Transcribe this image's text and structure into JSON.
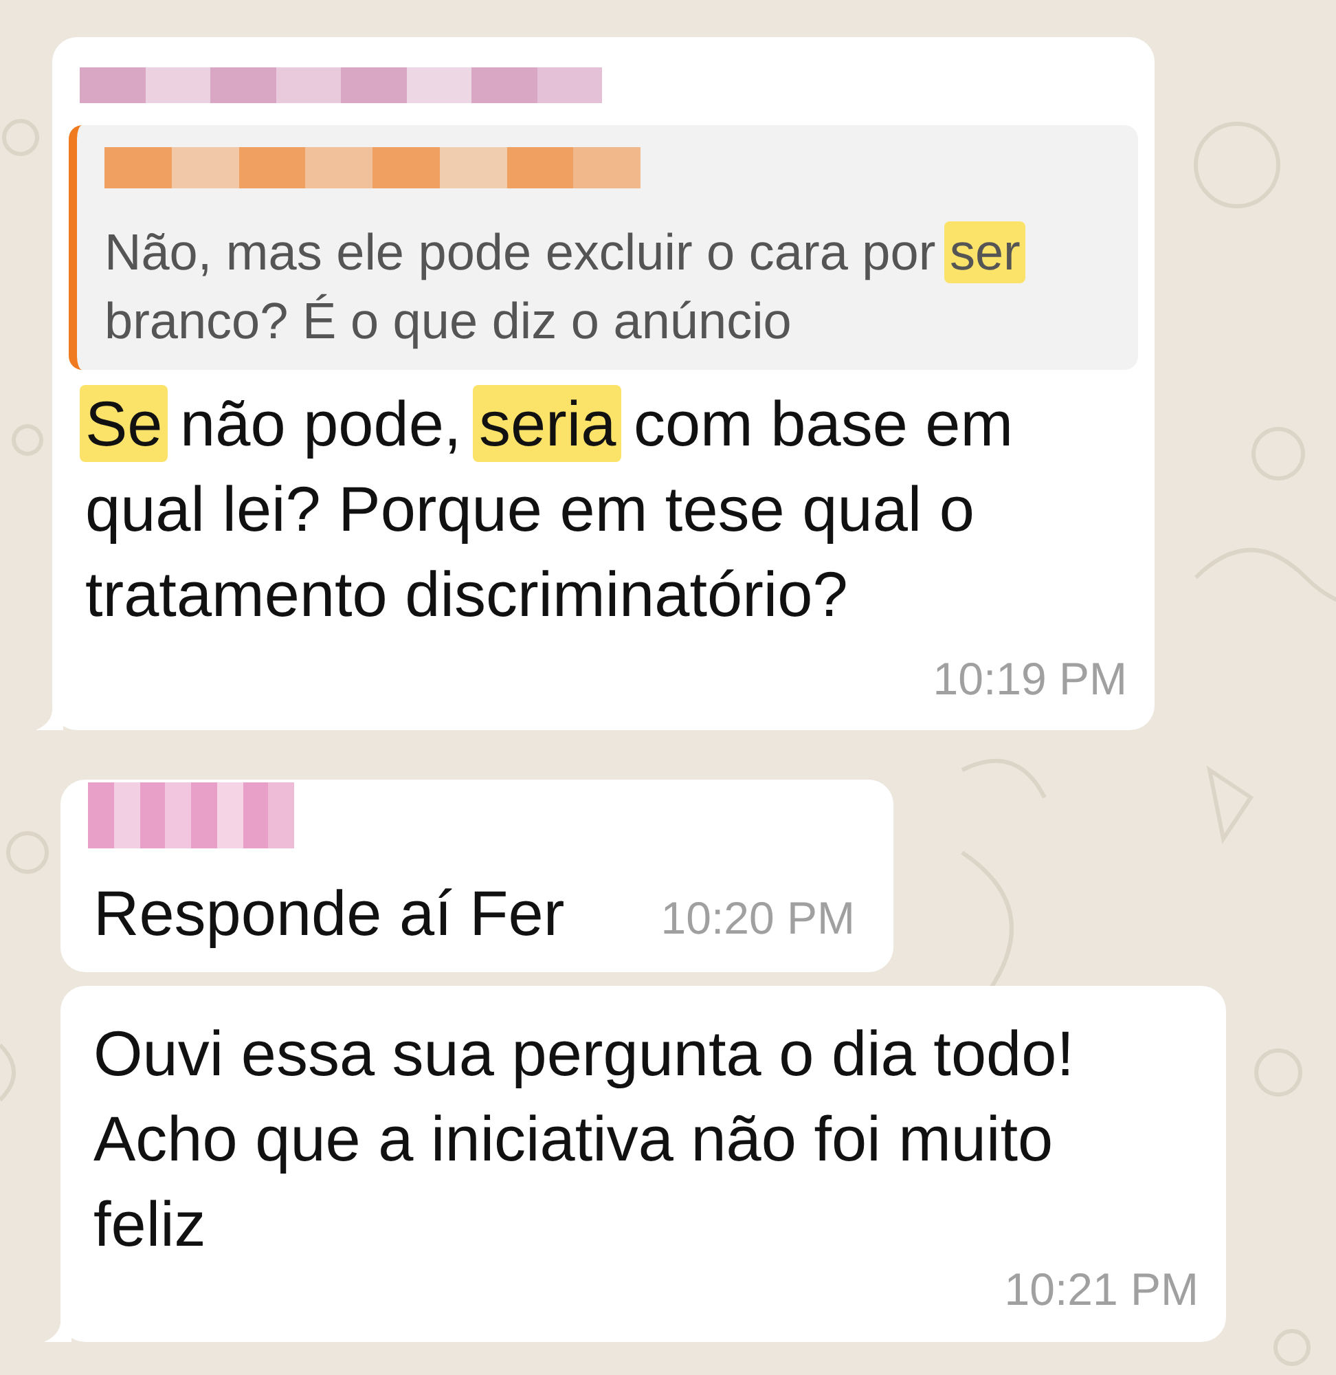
{
  "messages": [
    {
      "sender": {
        "redacted": true,
        "color": "#d9a6c4"
      },
      "quote": {
        "sender": {
          "redacted": true,
          "color": "#f0a060"
        },
        "segments": [
          {
            "text": "Não, mas ele pode excluir o cara por ",
            "highlight": false
          },
          {
            "text": "ser",
            "highlight": true
          },
          {
            "text": " branco? É o que diz o anúncio",
            "highlight": false
          }
        ]
      },
      "segments": [
        {
          "text": "Se",
          "highlight": true
        },
        {
          "text": " não pode, ",
          "highlight": false
        },
        {
          "text": "seria",
          "highlight": true
        },
        {
          "text": " com base em qual lei? Porque em tese qual o tratamento discriminatório?",
          "highlight": false
        }
      ],
      "time": "10:19 PM",
      "tail": true
    },
    {
      "sender": {
        "redacted": true,
        "color": "#e8a0c8"
      },
      "segments": [
        {
          "text": "Responde aí Fer",
          "highlight": false
        }
      ],
      "time": "10:20 PM",
      "tail": false
    },
    {
      "segments": [
        {
          "text": "Ouvi essa sua pergunta o dia todo! Acho que a iniciativa não foi muito feliz",
          "highlight": false
        }
      ],
      "time": "10:21 PM",
      "tail": true
    }
  ]
}
